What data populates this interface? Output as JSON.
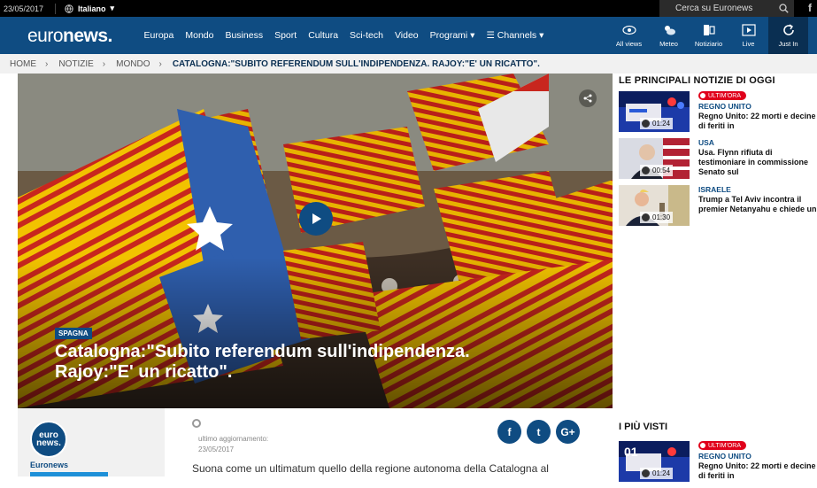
{
  "topbar": {
    "date": "23/05/2017",
    "language": "Italiano",
    "search_placeholder": "Cerca su Euronews",
    "facebook": "f"
  },
  "nav": {
    "logo_a": "euro",
    "logo_b": "news.",
    "links": [
      "Europa",
      "Mondo",
      "Business",
      "Sport",
      "Cultura",
      "Sci-tech",
      "Video",
      "Programi ▾",
      "☰ Channels ▾"
    ],
    "icons": [
      {
        "label": "All views",
        "icon": "eye-icon"
      },
      {
        "label": "Meteo",
        "icon": "weather-icon"
      },
      {
        "label": "Notiziario",
        "icon": "news-icon"
      },
      {
        "label": "Live",
        "icon": "play-icon"
      },
      {
        "label": "Just In",
        "icon": "refresh-icon"
      }
    ]
  },
  "breadcrumb": [
    "HOME",
    "NOTIZIE",
    "MONDO"
  ],
  "breadcrumb_current": "CATALOGNA:\"SUBITO REFERENDUM SULL'INDIPENDENZA. RAJOY:\"E' UN RICATTO\".",
  "hero": {
    "tag": "SPAGNA",
    "headline": "Catalogna:\"Subito referendum sull'indipendenza. Rajoy:\"E' un ricatto\"."
  },
  "top_news": {
    "title": "LE PRINCIPALI NOTIZIE DI OGGI",
    "items": [
      {
        "live": "ULTIM'ORA",
        "category": "REGNO UNITO",
        "title": "Regno Unito: 22 morti e decine di feriti in",
        "duration": "01:24"
      },
      {
        "live": "",
        "category": "USA",
        "title": "Usa. Flynn rifiuta di testimoniare in commissione Senato sul",
        "duration": "00:54"
      },
      {
        "live": "",
        "category": "ISRAELE",
        "title": "Trump a Tel Aviv incontra il premier Netanyahu e chiede un",
        "duration": "01:30"
      }
    ]
  },
  "most_viewed": {
    "title": "I PIÙ VISTI",
    "item": {
      "live": "ULTIM'ORA",
      "category": "REGNO UNITO",
      "title": "Regno Unito: 22 morti e decine di feriti in",
      "duration": "01:24",
      "rank": "01"
    }
  },
  "article": {
    "author_logo_a": "euro",
    "author_logo_b": "news.",
    "author": "Euronews",
    "updated_label": "ultimo aggiornamento:",
    "updated_date": "23/05/2017",
    "social": [
      "f",
      "t",
      "G+"
    ],
    "lead": "Suona come un ultimatum quello della regione autonoma della Catalogna al"
  }
}
